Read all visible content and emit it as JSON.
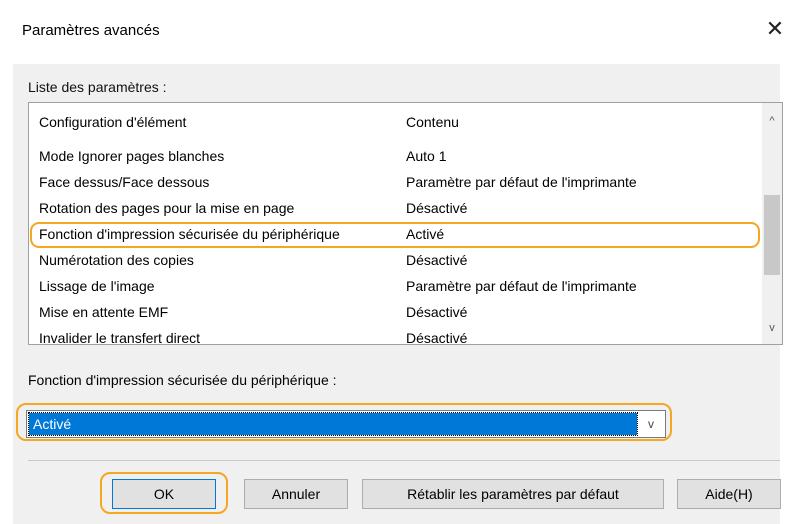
{
  "window": {
    "title": "Paramètres avancés",
    "close_glyph": "✕"
  },
  "list": {
    "label": "Liste des paramètres :",
    "columns": [
      "Configuration d'élément",
      "Contenu"
    ],
    "rows": [
      {
        "item": "Mode Ignorer pages blanches",
        "value": "Auto 1"
      },
      {
        "item": "Face dessus/Face dessous",
        "value": "Paramètre par défaut de l'imprimante"
      },
      {
        "item": "Rotation des pages pour la mise en page",
        "value": "Désactivé"
      },
      {
        "item": "Fonction d'impression sécurisée du périphérique",
        "value": "Activé"
      },
      {
        "item": "Numérotation des copies",
        "value": "Désactivé"
      },
      {
        "item": "Lissage de l'image",
        "value": "Paramètre par défaut de l'imprimante"
      },
      {
        "item": "Mise en attente EMF",
        "value": "Désactivé"
      },
      {
        "item": "Invalider le transfert direct",
        "value": "Désactivé"
      }
    ],
    "selected_index": 3,
    "scroll_up_glyph": "^",
    "scroll_down_glyph": "v"
  },
  "setting": {
    "label": "Fonction d'impression sécurisée du périphérique :",
    "value": "Activé",
    "arrow_glyph": "v"
  },
  "buttons": {
    "ok": "OK",
    "cancel": "Annuler",
    "reset": "Rétablir les paramètres par défaut",
    "help": "Aide(H)"
  },
  "colors": {
    "highlight": "#f5a623",
    "selection": "#0078d7"
  }
}
